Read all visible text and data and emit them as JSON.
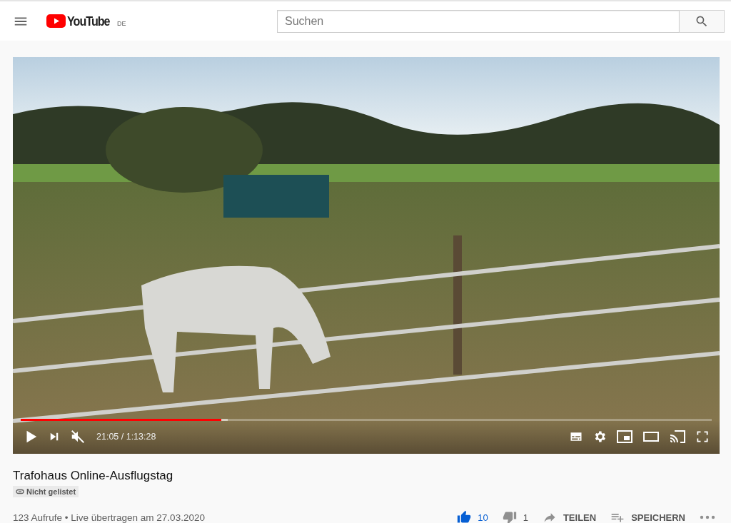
{
  "header": {
    "logo_text": "YouTube",
    "country": "DE",
    "search": {
      "placeholder": "Suchen"
    }
  },
  "player": {
    "progress": {
      "level": 0.29
    },
    "buffered": {
      "level": 0.3
    },
    "muted": true,
    "playing": false,
    "time": "21:05 / 1:13:28"
  },
  "video": {
    "title": "Trafohaus Online-Ausflugstag",
    "visibility_badge": "Nicht gelistet",
    "meta": "123 Aufrufe • Live übertragen am 27.03.2020"
  },
  "actions": [
    {
      "kind": "like",
      "label": "10",
      "selected": true
    },
    {
      "kind": "dislike",
      "label": "1",
      "selected": false
    },
    {
      "kind": "share",
      "label": "TEILEN",
      "selected": false
    },
    {
      "kind": "save",
      "label": "SPEICHERN",
      "selected": false
    },
    {
      "kind": "more"
    }
  ]
}
